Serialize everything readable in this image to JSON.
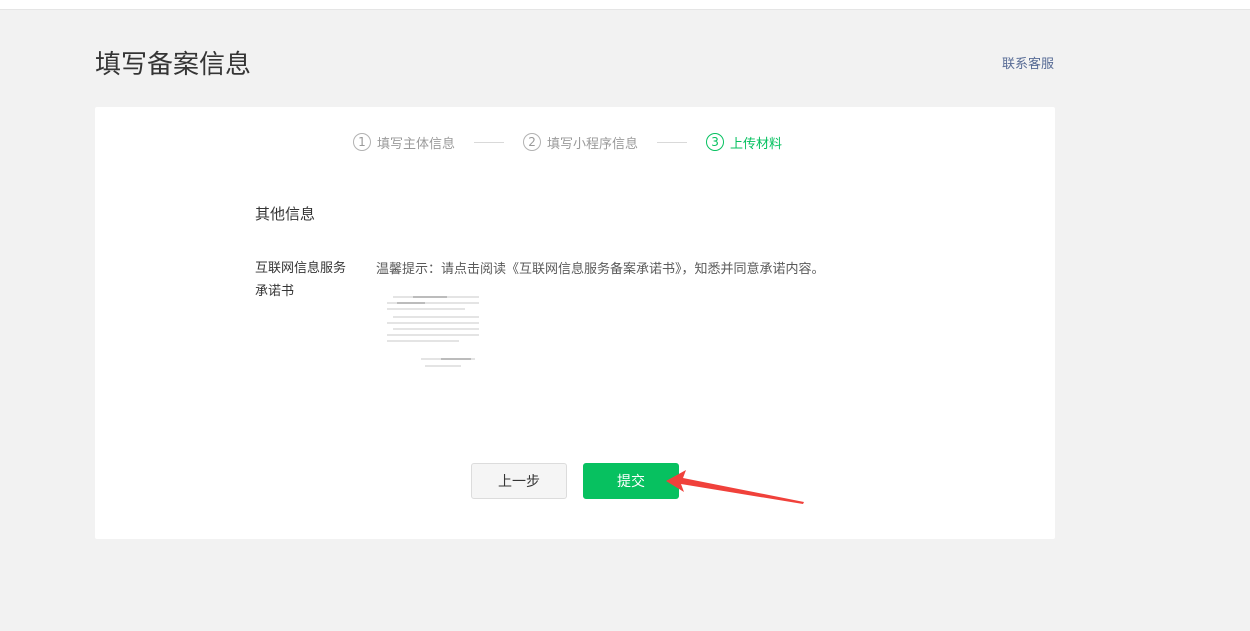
{
  "header": {
    "title": "填写备案信息",
    "contact_label": "联系客服"
  },
  "steps": [
    {
      "num": "1",
      "label": "填写主体信息",
      "active": false
    },
    {
      "num": "2",
      "label": "填写小程序信息",
      "active": false
    },
    {
      "num": "3",
      "label": "上传材料",
      "active": true
    }
  ],
  "section": {
    "title": "其他信息",
    "field_label_line1": "互联网信息服务",
    "field_label_line2": "承诺书",
    "tip": "温馨提示：请点击阅读《互联网信息服务备案承诺书》，知悉并同意承诺内容。",
    "document_icon": "commitment-document-thumbnail"
  },
  "buttons": {
    "prev_label": "上一步",
    "submit_label": "提交"
  },
  "colors": {
    "accent": "#07c160",
    "link": "#576b95",
    "annotation_arrow": "#f0413b"
  }
}
